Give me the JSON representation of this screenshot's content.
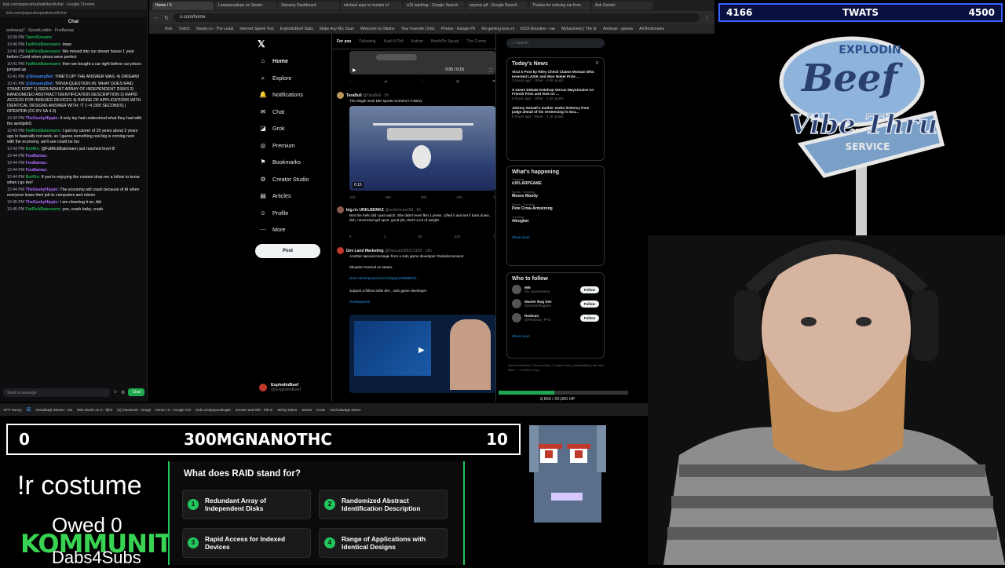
{
  "browser": {
    "tabs": [
      "Home / X",
      "Learnpeoplepe on Steam",
      "Streamy Dashboard",
      "michael aqui no temple of",
      "a10 warthog - Google Search",
      "anyone gif - Google Search",
      "Thanks for noticing me from",
      "Ask Gemini"
    ],
    "url": "x.com/home",
    "bookmarks": [
      "Kick",
      "Twitch",
      "Steam.co - The Leadi",
      "Internet Speed Test",
      "ExplodinBeef Stats",
      "Make Any Mic Soun",
      "Welcome to Oklaho",
      "Your Favorite | Kick",
      "Photos - Google Ph",
      "Re-gaming boss ni",
      "KICK Bounties - ear",
      "Mybusiness | The br",
      "Andreas - games",
      "All Bookmarks"
    ]
  },
  "chat": {
    "window_title": "kick.com/popout/explodinbeef/chat - Google Chrome",
    "url": "kick.com/popout/explodinbeef/chat",
    "header": "Chat",
    "input_placeholder": "Send a message",
    "send_label": "Chat",
    "pinned": "andreasg7 · SwordLordito · FooBamaz",
    "messages": [
      {
        "time": "10:39 PM",
        "user": "TatorStreamz:",
        "color": "green",
        "text": ""
      },
      {
        "time": "10:40 PM",
        "user": "FatRickBatemann:",
        "color": "green",
        "text": "lmao"
      },
      {
        "time": "10:41 PM",
        "user": "FatRickBatemann:",
        "color": "green",
        "text": "We moved into our dream house 1 year before Covid when prices were perfect"
      },
      {
        "time": "10:41 PM",
        "user": "FatRickBatemann:",
        "color": "green",
        "text": "then we bought a car right before car prices jumped up"
      },
      {
        "time": "10:41 PM",
        "user": "@StreamyBot:",
        "color": "blue",
        "text": "TIME'S UP! THE ANSWER WAS: 4) ORIGAMI"
      },
      {
        "time": "10:41 PM",
        "user": "@StreamyBot:",
        "color": "blue",
        "text": "TRIVIA QUESTION #5: WHAT DOES RAID STAND FOR? 1) REDUNDANT ARRAY OF INDEPENDENT DISKS 2) RANDOMIZED ABSTRACT IDENTIFICATION DESCRIPTION 3) RAPID ACCESS FOR INDEXED DEVICES 4) RANGE OF APPLICATIONS WITH IDENTICAL DESIGNS ANSWER WITH: !T 1~4 (300 SECONDS) | OPENTDB (CC BY-SA 4.0)"
      },
      {
        "time": "10:43 PM",
        "user": "TheGeekyHippie:",
        "color": "purple",
        "text": "if only tey had understood what they had with the aeolipile0."
      },
      {
        "time": "10:43 PM",
        "user": "FatRickBatemann:",
        "color": "green",
        "text": "I quit my career of 25 years about 2 years ago to basically not work, so I guess something real big is coming next with the economy, we'll see could be fun"
      },
      {
        "time": "10:43 PM",
        "user": "BotRix:",
        "color": "green",
        "text": "@FatRickBatemann just reached level 8!"
      },
      {
        "time": "10:44 PM",
        "user": "FooBamaz:",
        "color": "purple",
        "text": ""
      },
      {
        "time": "10:44 PM",
        "user": "FooBamaz:",
        "color": "purple",
        "text": ""
      },
      {
        "time": "10:44 PM",
        "user": "FooBamaz:",
        "color": "purple",
        "text": ""
      },
      {
        "time": "10:44 PM",
        "user": "BotRix:",
        "color": "green",
        "text": "If you're enjoying the content drop me a follow to know when i go live!"
      },
      {
        "time": "10:44 PM",
        "user": "TheGeekyHippie:",
        "color": "purple",
        "text": "The economy will crash because of AI when everyone loses their job to computers and robots"
      },
      {
        "time": "10:45 PM",
        "user": "TheGeekyHippie:",
        "color": "purple",
        "text": "I am cheering it on, tbh"
      },
      {
        "time": "10:45 PM",
        "user": "FatRickBatemann:",
        "color": "green",
        "text": "yes, crash baby, crash"
      }
    ]
  },
  "x": {
    "nav": [
      {
        "icon": "⌂",
        "label": "Home"
      },
      {
        "icon": "⌕",
        "label": "Explore"
      },
      {
        "icon": "🔔",
        "label": "Notifications"
      },
      {
        "icon": "✉",
        "label": "Chat"
      },
      {
        "icon": "◪",
        "label": "Grok"
      },
      {
        "icon": "◎",
        "label": "Premium"
      },
      {
        "icon": "⚑",
        "label": "Bookmarks"
      },
      {
        "icon": "⚙",
        "label": "Creator Studio"
      },
      {
        "icon": "▤",
        "label": "Articles"
      },
      {
        "icon": "☺",
        "label": "Profile"
      },
      {
        "icon": "⋯",
        "label": "More"
      }
    ],
    "post_button": "Post",
    "profile_name": "ExplodinBeef",
    "profile_handle": "@ExplodinBeef",
    "feed_tabs": [
      "For you",
      "Following",
      "Kush N Tell",
      "Autism",
      "BatchPlz Squad",
      "The Comm"
    ],
    "video_time": "0:05 / 0:15",
    "posts": [
      {
        "name": "TaraBull",
        "handle": "@TaraBull · 5h",
        "text": "The single most DEI sports moment in history",
        "duration": "0:15",
        "stats": [
          "104",
          "189",
          "895",
          "47K"
        ]
      },
      {
        "name": "big.ric UNKLBDNKZ",
        "handle": "@unclericoso58 · 6h",
        "text": "Wot the hello did I just watch. She didn't even fkin 1 press. Lifted it and set it back down.. duh, nevermind girl sport, good job, that's a lot of weight",
        "stats": [
          "8",
          "3",
          "50",
          "619"
        ]
      },
      {
        "name": "Dev Land Marketing",
        "handle": "@DevLand95213156 · 16h",
        "text": "Another special message from a solo game developer #solodevsurvivor",
        "text2": "Situation Normal on steam:",
        "link": "store.steampowered.com/app/1425890/Si...",
        "text3": "support a fellow indie dev , solo game developer",
        "tag": "#indiegames"
      }
    ],
    "search_placeholder": "Search",
    "todays_news_title": "Today's News",
    "news": [
      {
        "title": "Viral X Post by Riley Check Claims Woman Who Invented LASIK and Won Nobel Prize ...",
        "meta": "3 hours ago · Other · 4.6K posts"
      },
      {
        "title": "X Users Debate Ketchup Versus Mayonnaise on French Fries and Vote on ...",
        "meta": "5 hours ago · Other · 1.2K posts"
      },
      {
        "title": "Johnny Somali's mother seeks leniency from judge ahead of his sentencing in Sou...",
        "meta": "5 hours ago · News · 1.1K posts"
      }
    ],
    "happening_title": "What's happening",
    "trends": [
      {
        "cat": "Trending",
        "name": "#JKLARPGAME"
      },
      {
        "cat": "Sports · Trending",
        "name": "Moses Moody"
      },
      {
        "cat": "Sports · Trending",
        "name": "Pete Crow-Armstrong"
      },
      {
        "cat": "Trending",
        "name": "#drugtwt"
      }
    ],
    "show_more": "Show more",
    "wtf_title": "Who to follow",
    "wtf": [
      {
        "name": "Mi6",
        "handle": "@i_spearadmin"
      },
      {
        "name": "Master Bug Dev",
        "handle": "@masterbugdev"
      },
      {
        "name": "Redman",
        "handle": "@Redman_FPS"
      }
    ],
    "follow_label": "Follow",
    "footer": "Terms of Service | Privacy Policy | Cookie Policy | Accessibility | Ads info | More ··· © 2025 X Corp."
  },
  "hp": {
    "text": "8,656 / 20,000 HP",
    "fraction": 0.4328
  },
  "taskbar": {
    "items": [
      "ZaradDayl Stream - Mu",
      "Dba Dizzle on X: \"@Vi",
      "(4) Facebook - Googl",
      "Home / X - Google Chr",
      "kick.com/popout/exple",
      "emotes and shit - File E",
      "Sticky Notes",
      "Steam",
      "ICUE",
      "Void Salvage Demo"
    ],
    "weather": "75°F Sunny",
    "time": "10:45 PM",
    "date": "3/25/2025"
  },
  "scoreboard": {
    "left": "4166",
    "center": "TWATS",
    "right": "4500"
  },
  "logo": {
    "line1": "EXPLODIN",
    "line2": "Beef",
    "line3": "Vibe Thru",
    "line4": "SERVICE"
  },
  "bar2": {
    "left": "0",
    "center": "300MGNANOTHC",
    "right": "10"
  },
  "overlay": {
    "costume": "!r costume",
    "owed": "Owed 0",
    "kommunity": "KOMMUNITY",
    "dabs": "Dabs4Subs"
  },
  "trivia": {
    "question": "What does RAID stand for?",
    "answers": [
      {
        "num": "1",
        "text": "Redundant Array of Independent Disks"
      },
      {
        "num": "2",
        "text": "Randomized Abstract Identification Description"
      },
      {
        "num": "3",
        "text": "Rapid Access for Indexed Devices"
      },
      {
        "num": "4",
        "text": "Range of Applications with Identical Designs"
      }
    ]
  },
  "colors": {
    "accent_green": "#22c55e",
    "x_blue": "#1d9bf0",
    "score_blue": "#3a63ff"
  }
}
